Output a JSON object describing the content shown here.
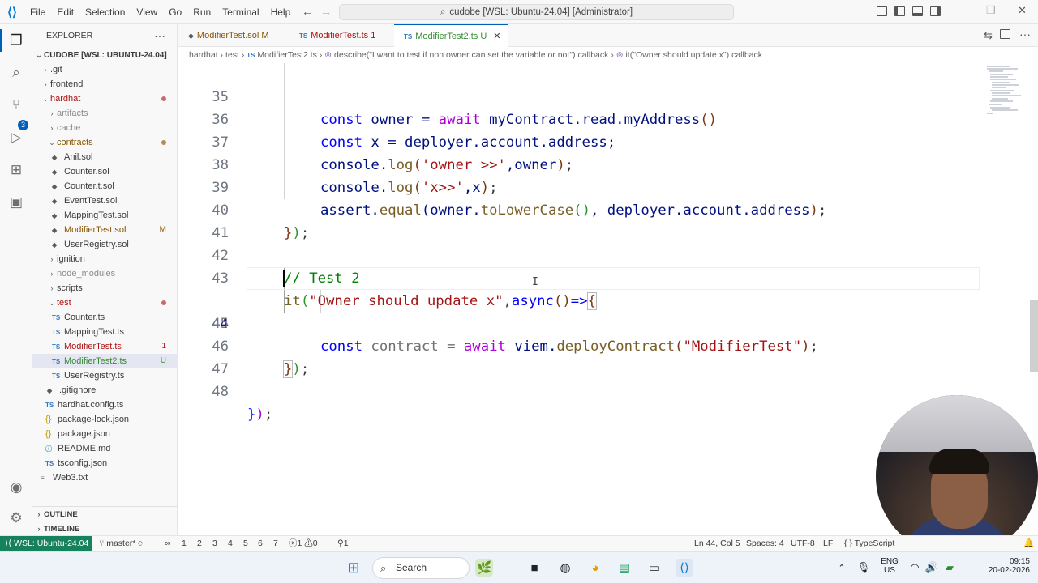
{
  "window": {
    "title": "cudobe [WSL: Ubuntu-24.04] [Administrator]",
    "menu": [
      "File",
      "Edit",
      "Selection",
      "View",
      "Go",
      "Run",
      "Terminal",
      "Help"
    ]
  },
  "sidebar": {
    "header": "EXPLORER",
    "root": "CUDOBE [WSL: UBUNTU-24.04]",
    "items": [
      {
        "label": ".git",
        "kind": "folder",
        "state": "collapsed"
      },
      {
        "label": "frontend",
        "kind": "folder",
        "state": "collapsed"
      },
      {
        "label": "hardhat",
        "kind": "folder",
        "state": "expanded"
      },
      {
        "label": "artifacts",
        "kind": "folder",
        "state": "collapsed"
      },
      {
        "label": "cache",
        "kind": "folder",
        "state": "collapsed"
      },
      {
        "label": "contracts",
        "kind": "folder",
        "state": "expanded"
      },
      {
        "label": "Anil.sol",
        "kind": "sol"
      },
      {
        "label": "Counter.sol",
        "kind": "sol"
      },
      {
        "label": "Counter.t.sol",
        "kind": "sol"
      },
      {
        "label": "EventTest.sol",
        "kind": "sol"
      },
      {
        "label": "MappingTest.sol",
        "kind": "sol"
      },
      {
        "label": "ModifierTest.sol",
        "kind": "sol",
        "badge": "M"
      },
      {
        "label": "UserRegistry.sol",
        "kind": "sol"
      },
      {
        "label": "ignition",
        "kind": "folder",
        "state": "collapsed"
      },
      {
        "label": "node_modules",
        "kind": "folder",
        "state": "collapsed"
      },
      {
        "label": "scripts",
        "kind": "folder",
        "state": "collapsed"
      },
      {
        "label": "test",
        "kind": "folder",
        "state": "expanded"
      },
      {
        "label": "Counter.ts",
        "kind": "ts",
        "icon": "TS"
      },
      {
        "label": "MappingTest.ts",
        "kind": "ts",
        "icon": "TS"
      },
      {
        "label": "ModifierTest.ts",
        "kind": "ts",
        "icon": "TS",
        "badge": "1"
      },
      {
        "label": "ModifierTest2.ts",
        "kind": "ts",
        "icon": "TS",
        "badge": "U"
      },
      {
        "label": "UserRegistry.ts",
        "kind": "ts",
        "icon": "TS"
      },
      {
        "label": ".gitignore",
        "kind": "file"
      },
      {
        "label": "hardhat.config.ts",
        "kind": "ts",
        "icon": "TS"
      },
      {
        "label": "package-lock.json",
        "kind": "json",
        "icon": "{}"
      },
      {
        "label": "package.json",
        "kind": "json",
        "icon": "{}"
      },
      {
        "label": "README.md",
        "kind": "md"
      },
      {
        "label": "tsconfig.json",
        "kind": "json",
        "icon": "TS"
      },
      {
        "label": "Web3.txt",
        "kind": "file"
      }
    ],
    "outline": "OUTLINE",
    "timeline": "TIMELINE"
  },
  "tabs": [
    {
      "label": "ModifierTest.sol",
      "badge": "M"
    },
    {
      "label": "ModifierTest.ts",
      "badge": "1",
      "icon": "TS"
    },
    {
      "label": "ModifierTest2.ts",
      "badge": "U",
      "icon": "TS",
      "active": true
    }
  ],
  "breadcrumb": [
    "hardhat",
    "test",
    "ModifierTest2.ts",
    "describe(\"I want to test if non owner can set the variable or not\") callback",
    "it(\"Owner should update x\") callback"
  ],
  "breadcrumb_file_icon": "TS",
  "editor": {
    "lines": [
      {
        "n": "35"
      },
      {
        "n": "36"
      },
      {
        "n": "37"
      },
      {
        "n": "38"
      },
      {
        "n": "39"
      },
      {
        "n": "40"
      },
      {
        "n": "41"
      },
      {
        "n": "42"
      },
      {
        "n": "43"
      },
      {
        "n": "44"
      },
      {
        "n": "45"
      },
      {
        "n": "46"
      },
      {
        "n": "47"
      },
      {
        "n": "48"
      }
    ],
    "tokens": {
      "l35": [
        "const",
        " owner = ",
        "await",
        " myContract.read.myAddress",
        "()"
      ],
      "l36": [
        "const",
        " x = deployer.account.address;"
      ],
      "l37": [
        "console.",
        "log",
        "(",
        "'owner >>'",
        ",owner",
        ")",
        ";"
      ],
      "l38": [
        "console.",
        "log",
        "(",
        "'x>>'",
        ",x",
        ")",
        ";"
      ],
      "l39": [
        "assert.",
        "equal",
        "(owner.",
        "toLowerCase",
        "()",
        ", deployer.account.address",
        ")",
        ";"
      ],
      "l40": [
        "}",
        ")",
        ";"
      ],
      "l42": [
        "// Test 2"
      ],
      "l43": [
        "it",
        "(",
        "\"Owner should update x\"",
        ",",
        "async",
        "()",
        "=>",
        "{"
      ],
      "l45": [
        "const",
        " contract = ",
        "await",
        " viem.",
        "deployContract",
        "(",
        "\"ModifierTest\"",
        ")",
        ";"
      ],
      "l46": [
        "}",
        ")",
        ";"
      ],
      "l48": [
        "}",
        ")",
        ";"
      ]
    }
  },
  "statusbar": {
    "remote": "WSL: Ubuntu-24.04",
    "branch": "master*",
    "sync": "∞",
    "nums": [
      "1",
      "2",
      "3",
      "4",
      "5",
      "6",
      "7"
    ],
    "problems": "1",
    "warnings": "0",
    "info": "1",
    "cursor": "Ln 44, Col 5",
    "spaces": "Spaces: 4",
    "encoding": "UTF-8",
    "eol": "LF",
    "language": "TypeScript"
  },
  "taskbar": {
    "search": "Search",
    "lang": "ENG",
    "region": "US",
    "time": "09:15",
    "date": "20-02-2026"
  },
  "colors": {
    "accent": "#005fb8",
    "remote": "#16825d",
    "modified": "#895503",
    "error": "#b01011",
    "untracked": "#388a34"
  }
}
